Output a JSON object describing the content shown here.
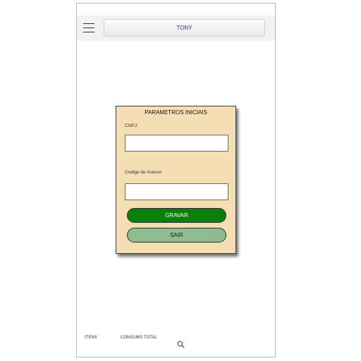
{
  "header": {
    "title": "TONY",
    "menu_icon": "hamburger-menu-icon"
  },
  "dialog": {
    "title": "PARAMETROS INICIAIS",
    "field1_label": "CNPJ:",
    "field1_value": "",
    "field2_label": "Codigo de Acesso",
    "field2_value": "",
    "gravar_label": "GRAVAR",
    "sair_label": "SAIR"
  },
  "footer": {
    "itens_label": "ITENS",
    "consumo_label": "CONSUMO TOTAL",
    "search_icon": "search-icon"
  },
  "colors": {
    "dialog_bg": "#f5deb3",
    "gravar_bg": "#0a7f0a",
    "sair_bg": "#8fbc8f",
    "title_text": "#2a2ad6"
  }
}
